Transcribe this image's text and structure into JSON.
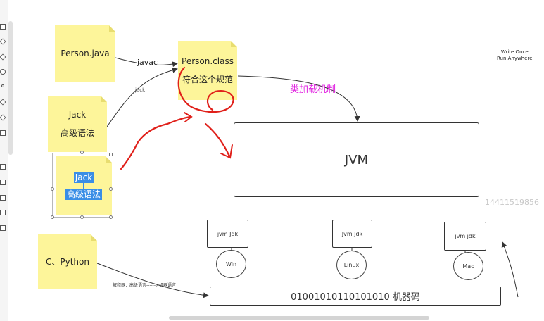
{
  "notes": {
    "person_java": "Person.java",
    "person_class": {
      "title": "Person.class",
      "sub": "符合这个规范"
    },
    "jack": {
      "title": "Jack",
      "sub": "高级语法"
    },
    "jack_selected": {
      "title": "Jack",
      "sub": "高级语法"
    },
    "c_python": "C、Python"
  },
  "edges": {
    "javac": "javac",
    "jack": "jack",
    "class_loader": "类加载机制",
    "interpreter": "解释器：高级语言------>机器语言"
  },
  "jvm": {
    "label": "JVM"
  },
  "jdk_boxes": [
    "jvm  Jdk",
    "Jvm   Jdk",
    "jvm   jdk"
  ],
  "os": [
    "Win",
    "Linux",
    "Mac"
  ],
  "machine_code": "01001010110101010   机器码",
  "slogan": {
    "line1": "Write Once",
    "line2": "Run Anywhere"
  },
  "watermark": "14411519856",
  "colors": {
    "note": "#fdf59a",
    "annotation_red": "#e0201a",
    "magenta": "#e020e0",
    "selection_blue": "#3a8ee6"
  }
}
